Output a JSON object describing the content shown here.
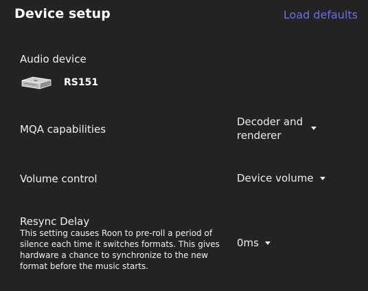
{
  "header": {
    "title": "Device setup",
    "load_defaults": "Load defaults"
  },
  "colors": {
    "background": "#232324",
    "accent": "#6f6fe6",
    "text": "#f2f2f2"
  },
  "audio_device": {
    "label": "Audio device",
    "icon": "audio-device-icon",
    "name": "RS151"
  },
  "mqa": {
    "label": "MQA capabilities",
    "value_line1": "Decoder and",
    "value_line2": "renderer",
    "icon": "caret-down-icon"
  },
  "volume": {
    "label": "Volume control",
    "value": "Device volume",
    "icon": "caret-down-icon"
  },
  "resync": {
    "label": "Resync Delay",
    "help": "This setting causes Roon to pre-roll a period of silence each time it switches formats. This gives hardware a chance to synchronize to the new format before the music starts.",
    "value": "0ms",
    "icon": "caret-down-icon"
  }
}
